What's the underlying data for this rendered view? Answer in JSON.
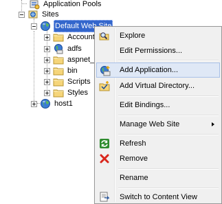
{
  "tree": {
    "nodes": [
      {
        "label": "Application Pools",
        "icon": "app-pools-icon"
      },
      {
        "label": "Sites",
        "icon": "sites-icon"
      },
      {
        "label": "Default Web Site",
        "icon": "globe-icon"
      },
      {
        "label": "Account",
        "icon": "folder-icon"
      },
      {
        "label": "adfs",
        "icon": "web-app-icon"
      },
      {
        "label": "aspnet_",
        "icon": "folder-icon"
      },
      {
        "label": "bin",
        "icon": "folder-icon"
      },
      {
        "label": "Scripts",
        "icon": "folder-icon"
      },
      {
        "label": "Styles",
        "icon": "folder-icon"
      },
      {
        "label": "host1",
        "icon": "globe-icon"
      }
    ]
  },
  "context_menu": {
    "items": [
      {
        "label": "Explore",
        "icon": "explore-icon"
      },
      {
        "label": "Edit Permissions..."
      },
      {
        "label": "Add Application...",
        "icon": "add-application-icon"
      },
      {
        "label": "Add Virtual Directory...",
        "icon": "add-virtual-directory-icon"
      },
      {
        "label": "Edit Bindings..."
      },
      {
        "label": "Manage Web Site"
      },
      {
        "label": "Refresh",
        "icon": "refresh-icon"
      },
      {
        "label": "Remove",
        "icon": "remove-icon"
      },
      {
        "label": "Rename"
      },
      {
        "label": "Switch to Content View",
        "icon": "content-view-icon"
      }
    ]
  },
  "colors": {
    "selection": "#3366cc",
    "menu_background": "#f0f0f0",
    "menu_hover": "#dfe8f6",
    "folder": "#f5d57a",
    "remove": "#d9261c",
    "refresh": "#2e8b2e"
  }
}
